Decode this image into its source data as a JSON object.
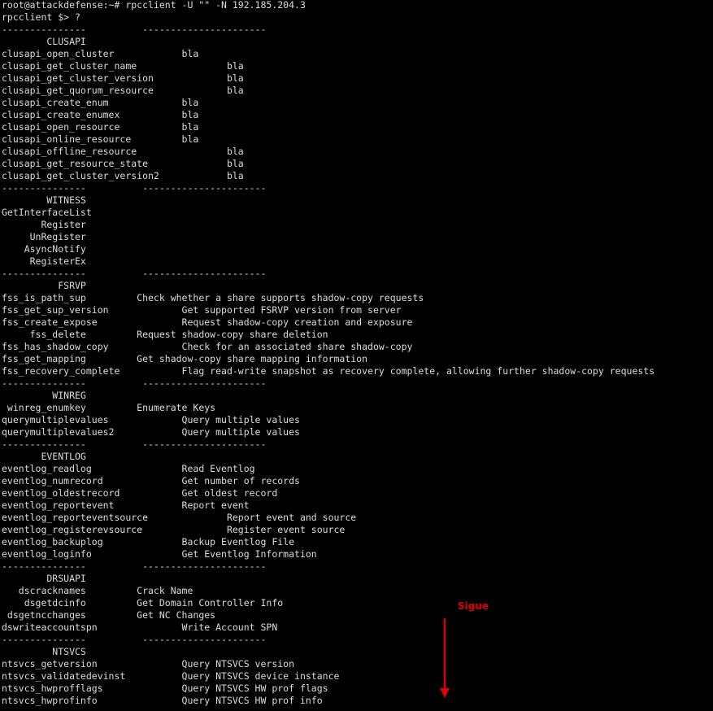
{
  "terminal": {
    "lines": [
      "root@attackdefense:~# rpcclient -U \"\" -N 192.185.204.3",
      "rpcclient $> ?",
      "---------------          ----------------------",
      "        CLUSAPI",
      "clusapi_open_cluster            bla",
      "clusapi_get_cluster_name                bla",
      "clusapi_get_cluster_version             bla",
      "clusapi_get_quorum_resource             bla",
      "clusapi_create_enum             bla",
      "clusapi_create_enumex           bla",
      "clusapi_open_resource           bla",
      "clusapi_online_resource         bla",
      "clusapi_offline_resource                bla",
      "clusapi_get_resource_state              bla",
      "clusapi_get_cluster_version2            bla",
      "---------------          ----------------------",
      "        WITNESS",
      "GetInterfaceList",
      "       Register",
      "     UnRegister",
      "    AsyncNotify",
      "     RegisterEx",
      "---------------          ----------------------",
      "          FSRVP",
      "fss_is_path_sup         Check whether a share supports shadow-copy requests",
      "fss_get_sup_version             Get supported FSRVP version from server",
      "fss_create_expose               Request shadow-copy creation and exposure",
      "     fss_delete         Request shadow-copy share deletion",
      "fss_has_shadow_copy             Check for an associated share shadow-copy",
      "fss_get_mapping         Get shadow-copy share mapping information",
      "fss_recovery_complete           Flag read-write snapshot as recovery complete, allowing further shadow-copy requests",
      "---------------          ----------------------",
      "         WINREG",
      " winreg_enumkey         Enumerate Keys",
      "querymultiplevalues             Query multiple values",
      "querymultiplevalues2            Query multiple values",
      "---------------          ----------------------",
      "       EVENTLOG",
      "eventlog_readlog                Read Eventlog",
      "eventlog_numrecord              Get number of records",
      "eventlog_oldestrecord           Get oldest record",
      "eventlog_reportevent            Report event",
      "eventlog_reporteventsource              Report event and source",
      "eventlog_registerevsource               Register event source",
      "eventlog_backuplog              Backup Eventlog File",
      "eventlog_loginfo                Get Eventlog Information",
      "---------------          ----------------------",
      "        DRSUAPI",
      "   dscracknames         Crack Name",
      "    dsgetdcinfo         Get Domain Controller Info",
      " dsgetncchanges         Get NC Changes",
      "dswriteaccountspn               Write Account SPN",
      "---------------          ----------------------",
      "         NTSVCS",
      "ntsvcs_getversion               Query NTSVCS version",
      "ntsvcs_validatedevinst          Query NTSVCS device instance",
      "ntsvcs_hwprofflags              Query NTSVCS HW prof flags",
      "ntsvcs_hwprofinfo               Query NTSVCS HW prof info"
    ]
  },
  "annotation": {
    "label": "Sigue",
    "arrow_icon": "down-arrow-icon",
    "color": "#e00000"
  },
  "colors": {
    "background": "#000000",
    "text": "#dcdcdc"
  }
}
